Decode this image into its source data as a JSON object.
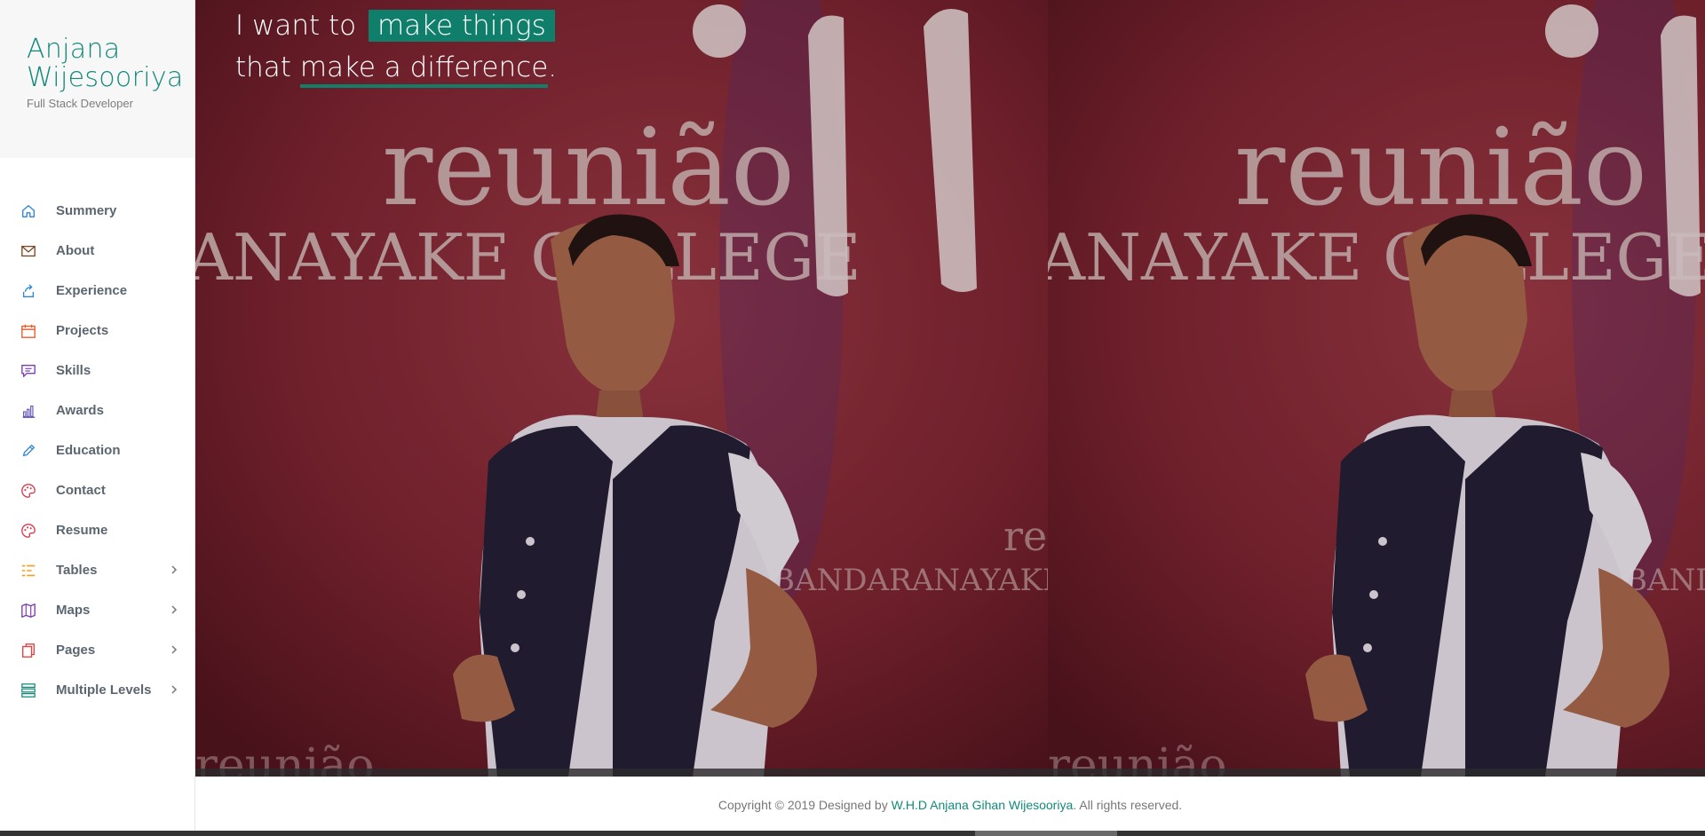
{
  "brand": {
    "name_line1": "Anjana",
    "name_line2": "Wijesooriya",
    "role": "Full Stack Developer"
  },
  "nav": [
    {
      "label": "Summery",
      "icon": "home-icon",
      "color": "#2f86d6",
      "chevron": false
    },
    {
      "label": "About",
      "icon": "envelope-icon",
      "color": "#7a4a24",
      "chevron": false
    },
    {
      "label": "Experience",
      "icon": "share-icon",
      "color": "#2f86d6",
      "chevron": false
    },
    {
      "label": "Projects",
      "icon": "calendar-icon",
      "color": "#e85b2d",
      "chevron": false
    },
    {
      "label": "Skills",
      "icon": "chat-icon",
      "color": "#7b3fb0",
      "chevron": false
    },
    {
      "label": "Awards",
      "icon": "bar-chart-icon",
      "color": "#5a4fb8",
      "chevron": false
    },
    {
      "label": "Education",
      "icon": "pencil-icon",
      "color": "#2f86d6",
      "chevron": false
    },
    {
      "label": "Contact",
      "icon": "palette-icon",
      "color": "#d63a4c",
      "chevron": false
    },
    {
      "label": "Resume",
      "icon": "palette-icon",
      "color": "#d63a4c",
      "chevron": false
    },
    {
      "label": "Tables",
      "icon": "list-icon",
      "color": "#f0a020",
      "chevron": true
    },
    {
      "label": "Maps",
      "icon": "map-icon",
      "color": "#7b3fb0",
      "chevron": true
    },
    {
      "label": "Pages",
      "icon": "pages-icon",
      "color": "#e84040",
      "chevron": true
    },
    {
      "label": "Multiple Levels",
      "icon": "levels-icon",
      "color": "#128a7a",
      "chevron": true
    }
  ],
  "hero": {
    "line1_prefix": "I want to",
    "line1_highlight": "make things",
    "line2_prefix": "that",
    "line2_underline": "make a difference",
    "line2_suffix": "."
  },
  "footer": {
    "prefix": "Copyright © 2019 Designed by",
    "link": "W.H.D Anjana Gihan Wijesooriya",
    "suffix": ". All rights reserved."
  },
  "colors": {
    "accent": "#128a7a",
    "highlight": "#0f7f6c"
  }
}
